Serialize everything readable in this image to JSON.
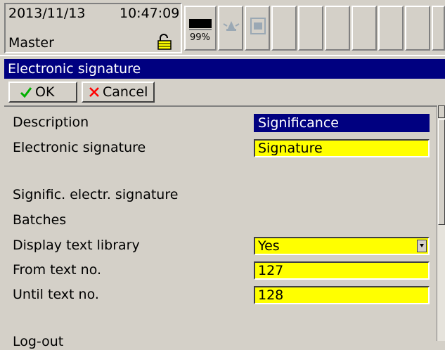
{
  "status": {
    "date": "2013/11/13",
    "time": "10:47:09",
    "user": "Master",
    "memory": "99%"
  },
  "dialog": {
    "title": "Electronic signature",
    "ok_label": "OK",
    "cancel_label": "Cancel"
  },
  "rows": {
    "description_label": "Description",
    "description_value": "Significance",
    "esig_label": "Electronic signature",
    "esig_value": "Signature",
    "signific_label": "Signific. electr. signature",
    "batches_label": "Batches",
    "display_text_label": "Display text library",
    "display_text_value": "Yes",
    "from_text_label": "From text no.",
    "from_text_value": "127",
    "until_text_label": "Until text no.",
    "until_text_value": "128",
    "logout_label": "Log-out"
  },
  "icons": [
    "lock-icon",
    "memory-card-icon",
    "alarm-icon",
    "message-icon",
    "check-icon",
    "x-icon",
    "dropdown-arrow-icon"
  ],
  "colors": {
    "title_bar": "#000080",
    "editable_field": "#ffff00",
    "selected_field": "#000080",
    "ok_check": "#00b000",
    "cancel_x": "#ff0000"
  }
}
